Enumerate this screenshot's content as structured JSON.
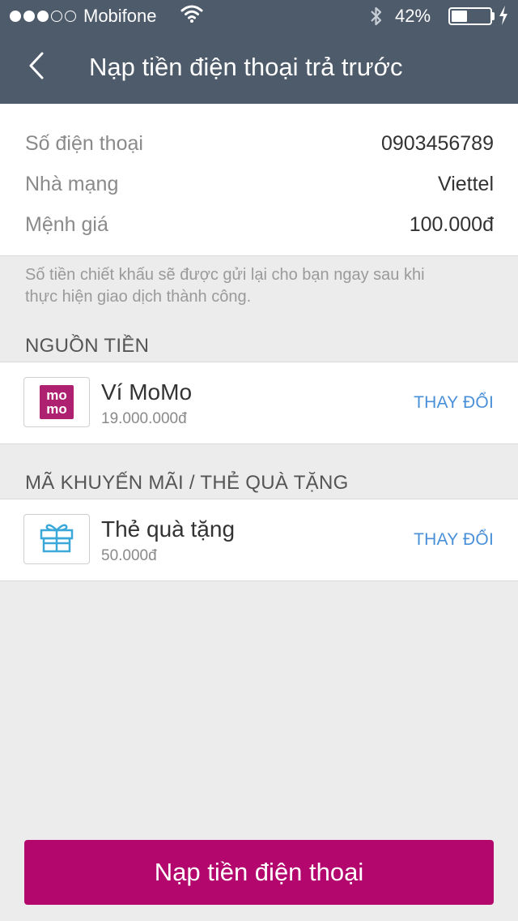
{
  "status_bar": {
    "carrier": "Mobifone",
    "signal_bars_filled": 3,
    "signal_bars_total": 5,
    "battery_percent_text": "42%",
    "battery_level": 0.42,
    "icons": [
      "wifi-icon",
      "bluetooth-icon",
      "battery-icon",
      "charging-bolt-icon"
    ]
  },
  "nav": {
    "title": "Nạp tiền điện thoại trả trước",
    "back_icon": "chevron-left-icon"
  },
  "summary": {
    "rows": [
      {
        "label": "Số điện thoại",
        "value": "0903456789"
      },
      {
        "label": "Nhà mạng",
        "value": "Viettel"
      },
      {
        "label": "Mệnh giá",
        "value": "100.000đ"
      }
    ],
    "note_line1": "Số tiền chiết khấu sẽ được gửi lại cho bạn ngay sau khi",
    "note_line2": "thực hiện giao dịch thành công."
  },
  "funding": {
    "section_title": "NGUỒN TIỀN",
    "logo_text_top": "mo",
    "logo_text_bottom": "mo",
    "title": "Ví MoMo",
    "balance": "19.000.000đ",
    "action": "THAY ĐỔI"
  },
  "promo": {
    "section_title": "MÃ KHUYẾN MÃI / THẺ QUÀ TẶNG",
    "icon": "gift-icon",
    "title": "Thẻ quà tặng",
    "amount": "50.000đ",
    "action": "THAY ĐỔI"
  },
  "cta": {
    "label": "Nạp tiền điện thoại"
  },
  "colors": {
    "header_bg": "#4e5b6b",
    "brand": "#b3076e",
    "link": "#4a90d9",
    "gift_icon": "#3aa8d8"
  }
}
